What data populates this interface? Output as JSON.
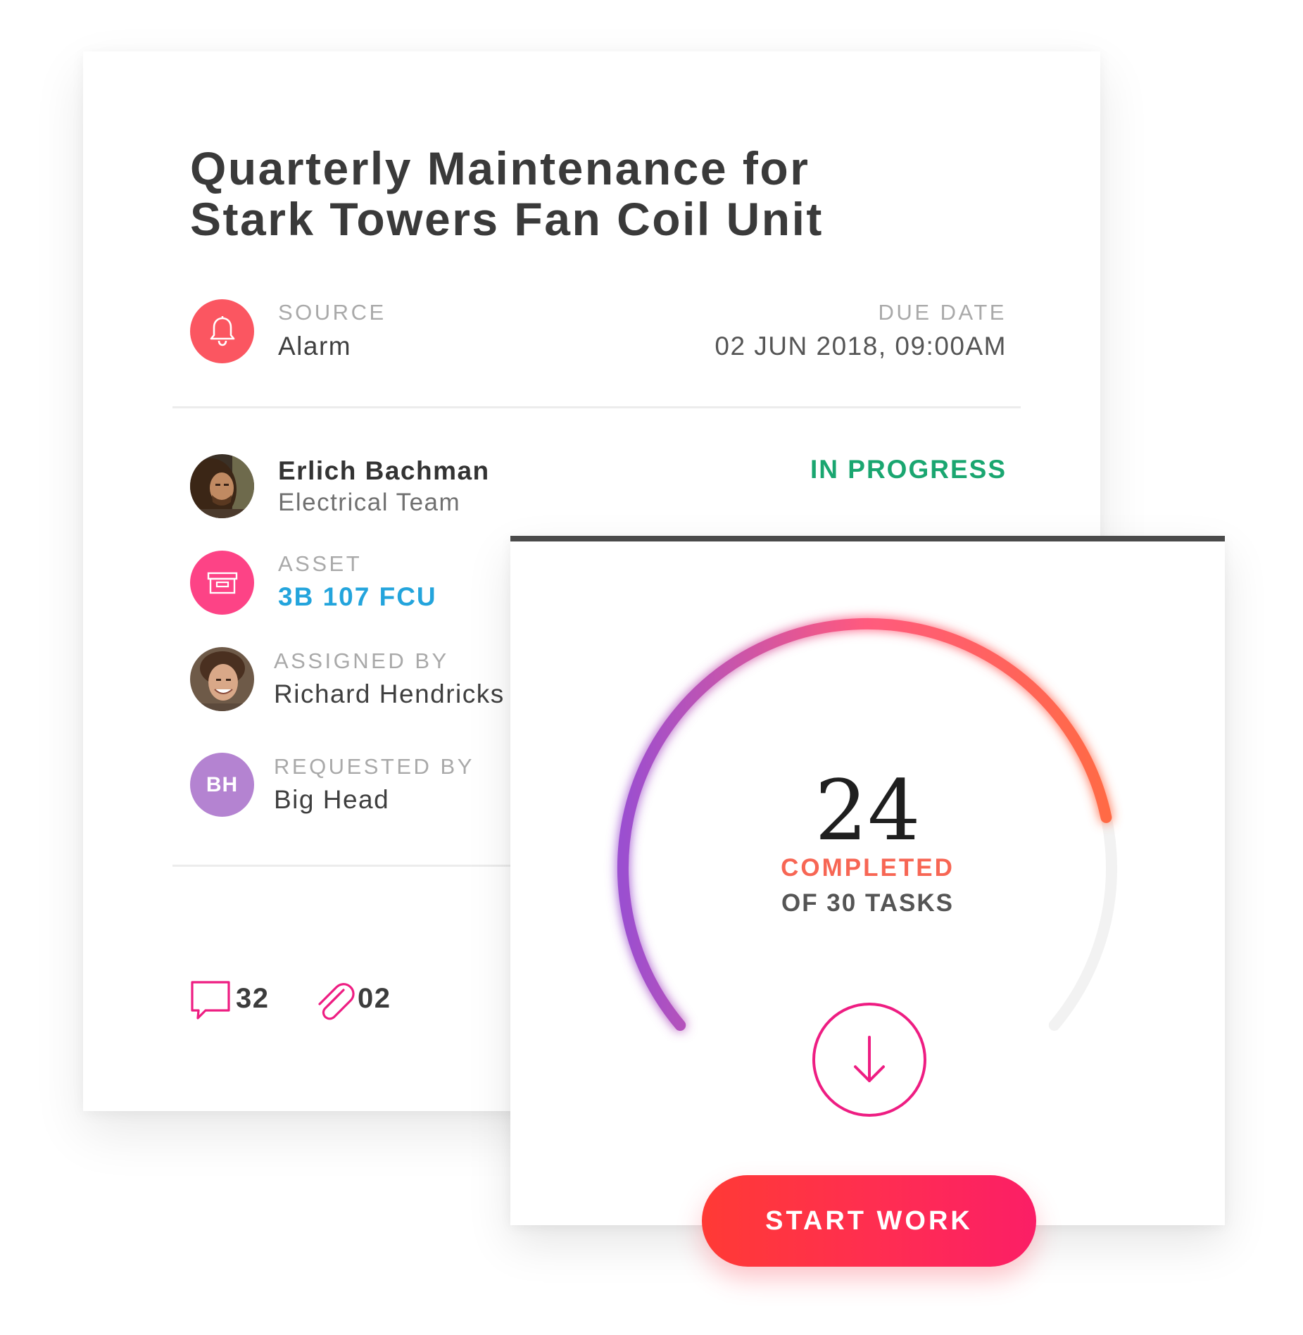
{
  "work_order": {
    "title_line1": "Quarterly Maintenance for",
    "title_line2": "Stark Towers Fan Coil Unit",
    "source": {
      "label": "SOURCE",
      "value": "Alarm",
      "icon": "bell-icon",
      "color": "#fb5661"
    },
    "due_date": {
      "label": "DUE DATE",
      "value": "02 JUN 2018, 09:00AM"
    },
    "assignee": {
      "name": "Erlich Bachman",
      "team": "Electrical Team"
    },
    "status": {
      "label": "IN PROGRESS",
      "color": "#1aa670"
    },
    "asset": {
      "label": "ASSET",
      "value": "3B 107 FCU",
      "icon": "archive-box-icon",
      "color": "#fd4386",
      "link_color": "#23a4dc"
    },
    "assigned_by": {
      "label": "ASSIGNED BY",
      "value": "Richard Hendricks"
    },
    "requested_by": {
      "label": "REQUESTED BY",
      "value": "Big Head",
      "initials": "BH",
      "color": "#b483d1"
    },
    "comments": {
      "icon": "comment-icon",
      "count": "32"
    },
    "attachments": {
      "icon": "paperclip-icon",
      "count": "02"
    }
  },
  "progress": {
    "completed_count": "24",
    "completed_label": "COMPLETED",
    "of_label": "OF 30 TASKS",
    "completed": 24,
    "total": 30,
    "download_icon": "arrow-down-icon",
    "gradient": [
      "#9b4fd0",
      "#ff5a7e",
      "#ff6a45"
    ]
  },
  "actions": {
    "start_label": "START WORK"
  }
}
